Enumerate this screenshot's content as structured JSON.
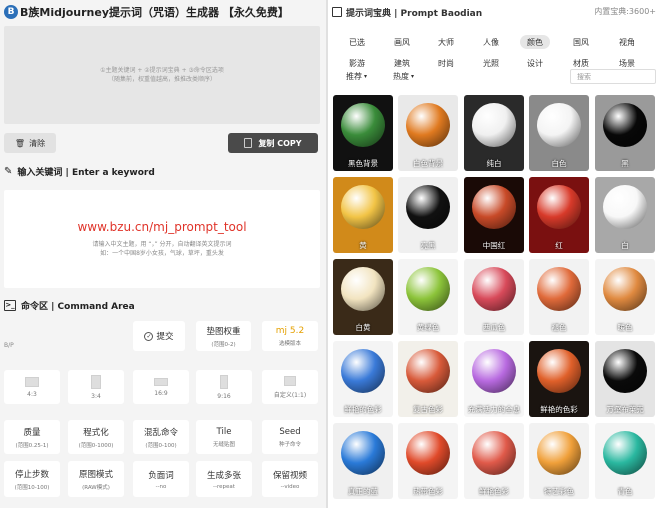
{
  "header": {
    "logo": "B",
    "title": "B族Midjourney提示词（咒语）生成器 【永久免费】"
  },
  "prompt_box": {
    "line1": "①主题关键词 + ②提示词宝典 + ③命令区选项",
    "line2": "（随集前，权重值越高，推推改类顺序）"
  },
  "buttons": {
    "clear": "清除",
    "copy": "复制  COPY"
  },
  "keyword_section": {
    "title": "输入关键词 | Enter a keyword",
    "url": "www.bzu.cn/mj_prompt_tool",
    "hint1": "请输入中文主题，用 “，” 分开，自动翻译英文提示词",
    "hint2": "如：一个中国8岁小女孩，气球，草坪，重头发"
  },
  "command_section": {
    "title": "命令区 | Command Area",
    "side_label": "B/P"
  },
  "cmd_row1": [
    {
      "t": "提交",
      "s": ""
    },
    {
      "t": "垫图权重",
      "s": "(范围0-2)"
    },
    {
      "t": "mj 5.2",
      "s": "选模版本"
    }
  ],
  "ratios": [
    "4:3",
    "3:4",
    "16:9",
    "9:16",
    "自定义(1:1)"
  ],
  "cmd_rows": [
    [
      {
        "t": "质量",
        "s": "(范围0.25-1)"
      },
      {
        "t": "程式化",
        "s": "(范围0-1000)"
      },
      {
        "t": "混乱命令",
        "s": "(范围0-100)"
      },
      {
        "t": "Tile",
        "s": "无缝贴图"
      },
      {
        "t": "Seed",
        "s": "种子命令"
      }
    ],
    [
      {
        "t": "停止步数",
        "s": "(范围10-100)"
      },
      {
        "t": "原图模式",
        "s": "(RAW模式)"
      },
      {
        "t": "负面词",
        "s": "--no"
      },
      {
        "t": "生成多张",
        "s": "--repeat"
      },
      {
        "t": "保留视频",
        "s": "--video"
      }
    ]
  ],
  "right": {
    "title": "提示词宝典 | Prompt Baodian",
    "count": "内置宝典:3600+",
    "categories": [
      [
        "已选",
        "画风",
        "大师",
        "人像",
        "颜色",
        "国风",
        "视角"
      ],
      [
        "影游",
        "建筑",
        "时尚",
        "光照",
        "设计",
        "材质",
        "场景"
      ]
    ],
    "active_category": "颜色",
    "filters": [
      "推荐",
      "热度"
    ],
    "search_placeholder": "搜索",
    "tiles": [
      {
        "cap": "黑色背景",
        "bg": "#111111",
        "ball": "#3a8c3a"
      },
      {
        "cap": "白色背景",
        "bg": "#e9e9e9",
        "ball": "#e07a20"
      },
      {
        "cap": "纯白",
        "bg": "#2a2a2a",
        "ball": "#f0f0f0"
      },
      {
        "cap": "白色",
        "bg": "#8a8a8a",
        "ball": "#f4f4f4"
      },
      {
        "cap": "黑",
        "bg": "#9a9a9a",
        "ball": "#080808"
      },
      {
        "cap": "黄",
        "bg": "#d18a1a",
        "ball": "#f2c446"
      },
      {
        "cap": "亮黑",
        "bg": "#f0f0f0",
        "ball": "#111111"
      },
      {
        "cap": "中国红",
        "bg": "#1a0a06",
        "ball": "#c84a28"
      },
      {
        "cap": "红",
        "bg": "#7a1010",
        "ball": "#d83a2a"
      },
      {
        "cap": "白",
        "bg": "#a8a8a8",
        "ball": "#f8f8f8"
      },
      {
        "cap": "白黄",
        "bg": "#3a2a18",
        "ball": "#f2e4c0"
      },
      {
        "cap": "黄绿色",
        "bg": "#f4f4f4",
        "ball": "#8cc43a"
      },
      {
        "cap": "西瓜色",
        "bg": "#f2f2f2",
        "ball": "#d84a5a"
      },
      {
        "cap": "褪色",
        "bg": "#f2f2f2",
        "ball": "#e06a3a"
      },
      {
        "cap": "暖色",
        "bg": "#f4f4f4",
        "ball": "#e08a40"
      },
      {
        "cap": "鲜艳的色彩",
        "bg": "#f4f4f4",
        "ball": "#3a7ad8"
      },
      {
        "cap": "复古色彩",
        "bg": "#f2f0ea",
        "ball": "#d85a3a"
      },
      {
        "cap": "充满活力的全息",
        "bg": "#f6f6f6",
        "ball": "#b86ae0"
      },
      {
        "cap": "鲜艳的色彩",
        "bg": "#1a1410",
        "ball": "#e0602a"
      },
      {
        "cap": "万壑布莱克",
        "bg": "#e4e4e4",
        "ball": "#0a0a0a"
      },
      {
        "cap": "真正的蓝",
        "bg": "#f0f0f0",
        "ball": "#2a7ad8"
      },
      {
        "cap": "热带色彩",
        "bg": "#f4f4f4",
        "ball": "#e04a2a"
      },
      {
        "cap": "鲜艳色彩",
        "bg": "#f4f4f4",
        "ball": "#e05a4a"
      },
      {
        "cap": "特艺彩色",
        "bg": "#f2f2f2",
        "ball": "#f0a03a"
      },
      {
        "cap": "青色",
        "bg": "#f4f4f4",
        "ball": "#2ab8a0"
      }
    ]
  }
}
